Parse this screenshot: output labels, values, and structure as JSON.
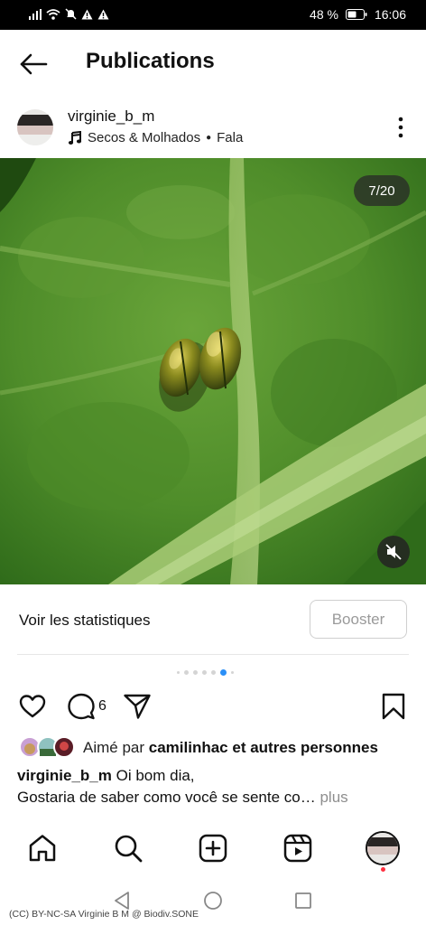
{
  "status_bar": {
    "battery": "48 %",
    "time": "16:06"
  },
  "header": {
    "title": "Publications"
  },
  "post": {
    "username": "virginie_b_m",
    "music": "Secos & Molhados",
    "music_extra": "Fala",
    "image_counter": "7/20",
    "stats_label": "Voir les statistiques",
    "boost_label": "Booster",
    "comment_count": "6",
    "likes_prefix": "Aimé par",
    "likes_user": "camilinhac",
    "likes_suffix": "et autres personnes",
    "caption_user": "virginie_b_m",
    "caption_line1": "Oi bom dia,",
    "caption_line2": "Gostaria de saber como você se sente co…",
    "caption_more": "plus"
  },
  "credit": "(CC) BY-NC-SA     Virginie B M @ Biodiv.SONE",
  "icons": {
    "back": "arrow-left-icon",
    "more": "more-vertical-icon",
    "music": "music-note-icon",
    "mute": "muted-speaker-icon",
    "like": "heart-icon",
    "comment": "comment-icon",
    "share": "send-icon",
    "save": "bookmark-icon",
    "home": "home-icon",
    "search": "search-icon",
    "create": "plus-square-icon",
    "reels": "reels-icon"
  },
  "colors": {
    "accent": "#2a8ff7",
    "notification": "#ff3040",
    "muted_text": "#8e8e8e"
  },
  "carousel": {
    "total_dots": 6,
    "active_index": 4
  }
}
